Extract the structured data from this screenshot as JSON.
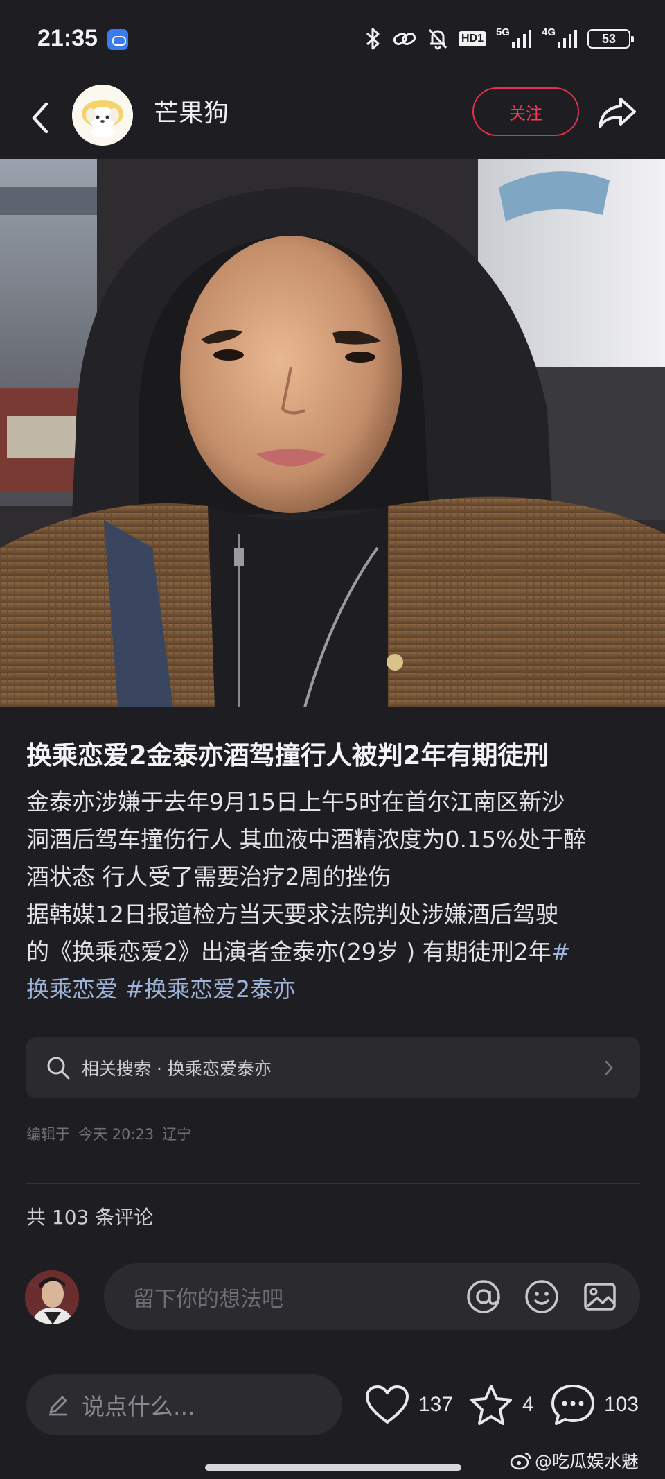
{
  "status_bar": {
    "time": "21:35",
    "hd_label": "HD1",
    "net_5g": "5G",
    "net_4g": "4G",
    "battery": "53"
  },
  "header": {
    "author_name": "芒果狗",
    "follow_label": "关注"
  },
  "post": {
    "title": "换乘恋爱2金泰亦酒驾撞行人被判2年有期徒刑",
    "body_lines": [
      "金泰亦涉嫌于去年9月15日上午5时在首尔江南区新沙",
      "洞酒后驾车撞伤行人 其血液中酒精浓度为0.15%处于醉",
      "酒状态 行人受了需要治疗2周的挫伤",
      "据韩媒12日报道检方当天要求法院判处涉嫌酒后驾驶",
      "的《换乘恋爱2》出演者金泰亦(29岁 ) 有期徒刑2年"
    ],
    "hashtag_1_a": "#",
    "hashtag_1_b": "换乘恋爱",
    "hashtag_2": "#换乘恋爱2泰亦"
  },
  "related_search": {
    "label": "相关搜索 · 换乘恋爱泰亦"
  },
  "edit_info": {
    "prefix": "编辑于",
    "time": "今天 20:23",
    "location": "辽宁"
  },
  "comments": {
    "count_label": "共 103 条评论",
    "input_placeholder": "留下你的想法吧"
  },
  "bottom_bar": {
    "input_placeholder": "说点什么...",
    "likes": "137",
    "stars": "4",
    "comments": "103"
  },
  "watermark": "@吃瓜娱水魅"
}
